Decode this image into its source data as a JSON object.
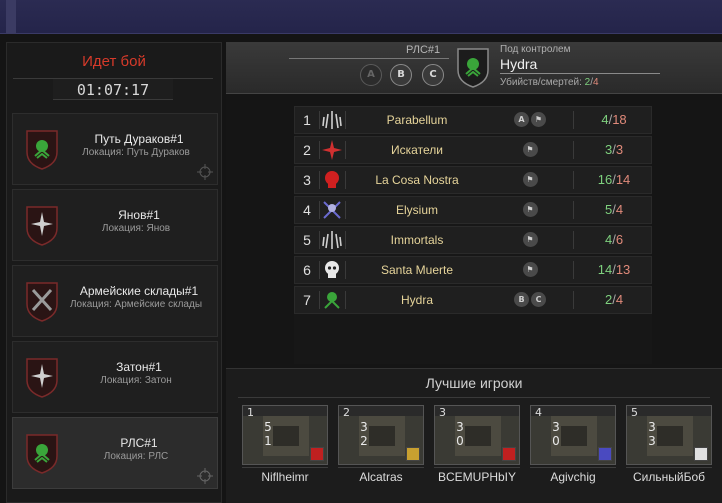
{
  "battle": {
    "title": "Идет бой",
    "timer": "01:07:17"
  },
  "locations": [
    {
      "title": "Путь Дураков#1",
      "sub": "Локация: Путь Дураков",
      "emblem": "hydra-emblem-icon"
    },
    {
      "title": "Янов#1",
      "sub": "Локация: Янов",
      "emblem": "compass-star-icon"
    },
    {
      "title": "Армейские склады#1",
      "sub": "Локация: Армейские склады",
      "emblem": "crossed-swords-icon"
    },
    {
      "title": "Затон#1",
      "sub": "Локация: Затон",
      "emblem": "compass-star-icon"
    },
    {
      "title": "РЛС#1",
      "sub": "Локация: РЛС",
      "emblem": "hydra-emblem-icon"
    }
  ],
  "header": {
    "point": "РЛС#1",
    "caps": [
      "A",
      "B",
      "C"
    ],
    "control_label": "Под контролем",
    "control_name": "Hydra",
    "stats_label": "Убийств/смертей:",
    "kills": "2",
    "deaths": "4"
  },
  "clans": [
    {
      "rank": "1",
      "name": "Parabellum",
      "caps": [
        "A",
        "flag"
      ],
      "kills": "4",
      "deaths": "18",
      "emblem": "wings-emblem-icon"
    },
    {
      "rank": "2",
      "name": "Искатели",
      "caps": [
        "flag"
      ],
      "kills": "3",
      "deaths": "3",
      "emblem": "red-compass-emblem-icon"
    },
    {
      "rank": "3",
      "name": "La Cosa Nostra",
      "caps": [
        "flag"
      ],
      "kills": "16",
      "deaths": "14",
      "emblem": "red-skull-emblem-icon"
    },
    {
      "rank": "4",
      "name": "Elysium",
      "caps": [
        "flag"
      ],
      "kills": "5",
      "deaths": "4",
      "emblem": "blue-crossbones-emblem-icon"
    },
    {
      "rank": "5",
      "name": "Immortals",
      "caps": [
        "flag"
      ],
      "kills": "4",
      "deaths": "6",
      "emblem": "wings-emblem-icon"
    },
    {
      "rank": "6",
      "name": "Santa Muerte",
      "caps": [
        "flag"
      ],
      "kills": "14",
      "deaths": "13",
      "emblem": "white-skull-emblem-icon"
    },
    {
      "rank": "7",
      "name": "Hydra",
      "caps": [
        "B",
        "C"
      ],
      "kills": "2",
      "deaths": "4",
      "emblem": "hydra-emblem-icon"
    }
  ],
  "best_players": {
    "title": "Лучшие игроки",
    "players": [
      {
        "rank": "1",
        "top": "5",
        "bottom": "1",
        "name": "Niflheimr",
        "badge": "red-skull-badge-icon"
      },
      {
        "rank": "2",
        "top": "3",
        "bottom": "2",
        "name": "Alcatras",
        "badge": "gold-badge-icon"
      },
      {
        "rank": "3",
        "top": "3",
        "bottom": "0",
        "name": "BCEMUPHbIY",
        "badge": "red-skull-badge-icon"
      },
      {
        "rank": "4",
        "top": "3",
        "bottom": "0",
        "name": "Agivchig",
        "badge": "blue-badge-icon"
      },
      {
        "rank": "5",
        "top": "3",
        "bottom": "3",
        "name": "СильныйБоб",
        "badge": "white-skull-badge-icon"
      }
    ]
  },
  "colors": {
    "accent_red": "#d63a2a",
    "clan_name": "#e6d49a",
    "kills": "#7ed07e",
    "deaths": "#e08a7a",
    "topbar": "#2b2b52"
  }
}
